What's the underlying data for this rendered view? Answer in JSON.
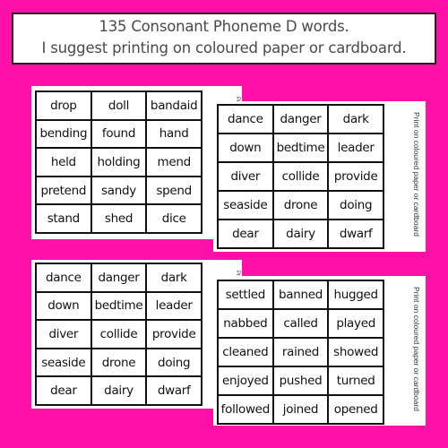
{
  "header": {
    "line1": "135 Consonant Phoneme D words.",
    "line2": "I suggest printing on coloured paper or cardboard."
  },
  "colors": {
    "background": "#ff11a8",
    "card": "#ffffff",
    "text": "#111111",
    "header_text": "#4a4a4a"
  },
  "cards": [
    {
      "words": [
        "drop",
        "doll",
        "bandaid",
        "bending",
        "found",
        "hand",
        "held",
        "holding",
        "mend",
        "pretend",
        "sandy",
        "spend",
        "stand",
        "shed",
        "dice"
      ],
      "side_note": "",
      "peek": "Pr"
    },
    {
      "words": [
        "dance",
        "danger",
        "dark",
        "down",
        "bedtime",
        "leader",
        "diver",
        "collide",
        "provide",
        "seaside",
        "drone",
        "doing",
        "dear",
        "dairy",
        "dwarf"
      ],
      "side_note": "Print on coloured paper or cardboard",
      "peek": ""
    },
    {
      "words": [
        "dance",
        "danger",
        "dark",
        "down",
        "bedtime",
        "leader",
        "diver",
        "collide",
        "provide",
        "seaside",
        "drone",
        "doing",
        "dear",
        "dairy",
        "dwarf"
      ],
      "side_note": "",
      "peek": "Pr"
    },
    {
      "words": [
        "settled",
        "banned",
        "hugged",
        "nabbed",
        "called",
        "played",
        "cleaned",
        "rained",
        "showed",
        "enjoyed",
        "pushed",
        "turned",
        "followed",
        "joined",
        "opened"
      ],
      "side_note": "Print on coloured paper or cardboard",
      "peek": ""
    }
  ]
}
